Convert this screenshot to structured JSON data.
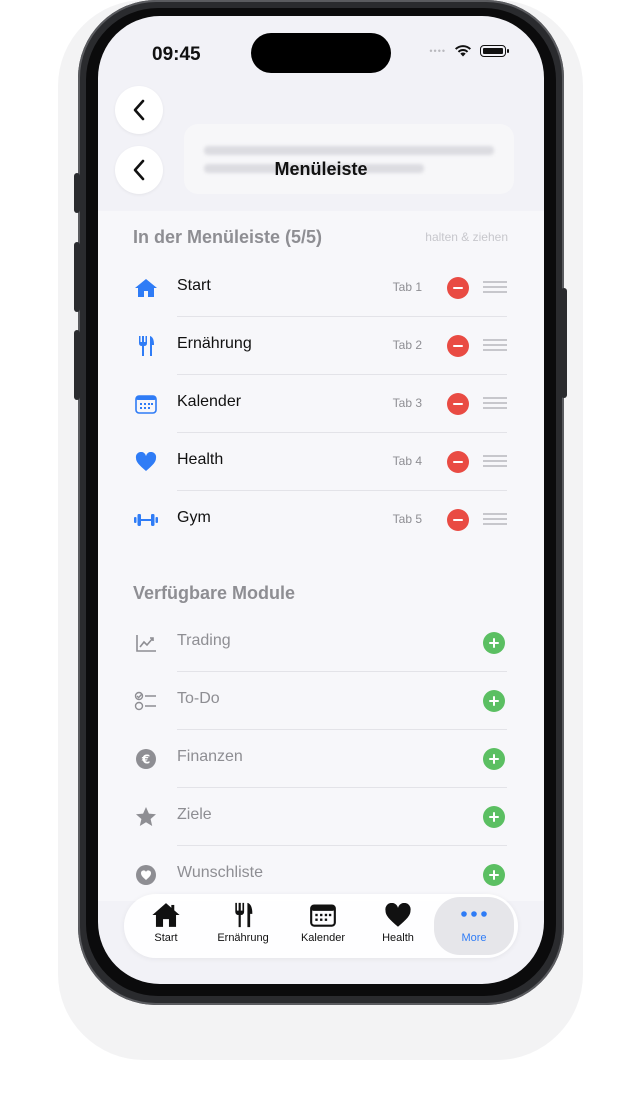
{
  "status_bar": {
    "time": "09:45"
  },
  "nav": {
    "title": "Menüleiste"
  },
  "menu_section": {
    "title": "In der Menüleiste (5/5)",
    "hint": "halten & ziehen",
    "items": [
      {
        "label": "Start",
        "tab": "Tab 1",
        "icon": "house-icon"
      },
      {
        "label": "Ernährung",
        "tab": "Tab 2",
        "icon": "fork-knife-icon"
      },
      {
        "label": "Kalender",
        "tab": "Tab 3",
        "icon": "calendar-icon"
      },
      {
        "label": "Health",
        "tab": "Tab 4",
        "icon": "heart-icon"
      },
      {
        "label": "Gym",
        "tab": "Tab 5",
        "icon": "dumbbell-icon"
      }
    ]
  },
  "available_section": {
    "title": "Verfügbare Module",
    "items": [
      {
        "label": "Trading",
        "icon": "chart-line-icon"
      },
      {
        "label": "To-Do",
        "icon": "checklist-icon"
      },
      {
        "label": "Finanzen",
        "icon": "euro-icon"
      },
      {
        "label": "Ziele",
        "icon": "star-icon"
      },
      {
        "label": "Wunschliste",
        "icon": "heart-circle-icon"
      }
    ]
  },
  "tab_bar": {
    "items": [
      {
        "label": "Start",
        "icon": "house-icon"
      },
      {
        "label": "Ernährung",
        "icon": "fork-knife-icon"
      },
      {
        "label": "Kalender",
        "icon": "calendar-icon"
      },
      {
        "label": "Health",
        "icon": "heart-icon"
      },
      {
        "label": "More",
        "icon": "ellipsis-icon",
        "active": true
      }
    ]
  },
  "colors": {
    "accent": "#2f7cf6",
    "remove": "#e94b43",
    "add": "#5bbf62",
    "muted": "#8e8e93"
  }
}
